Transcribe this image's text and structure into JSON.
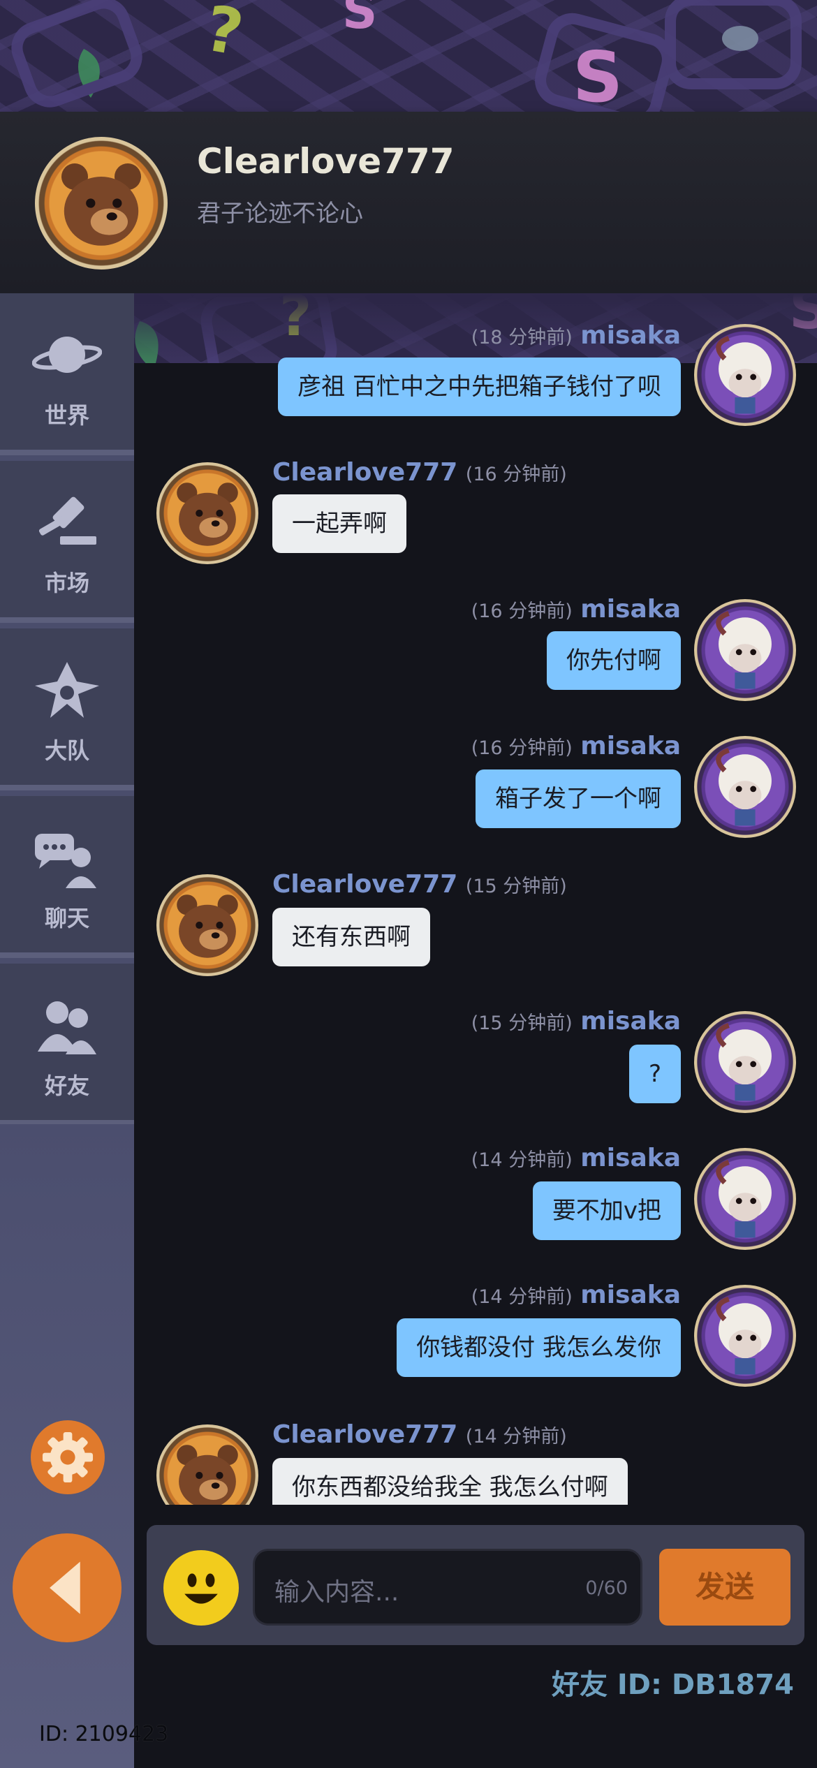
{
  "header": {
    "name": "Clearlove777",
    "motto": "君子论迹不论心"
  },
  "sidebar": {
    "items": [
      {
        "label": "世界",
        "icon": "planet-icon"
      },
      {
        "label": "市场",
        "icon": "gavel-icon"
      },
      {
        "label": "大队",
        "icon": "guild-emblem-icon"
      },
      {
        "label": "聊天",
        "icon": "chat-icon"
      },
      {
        "label": "好友",
        "icon": "friends-icon"
      }
    ],
    "settings_icon": "gear-icon",
    "back_icon": "back-arrow-icon"
  },
  "messages": [
    {
      "sender": "misaka",
      "time": "(18 分钟前)",
      "text": "彦祖 百忙中之中先把箱子钱付了呗",
      "mine": true
    },
    {
      "sender": "Clearlove777",
      "time": "(16 分钟前)",
      "text": "一起弄啊",
      "mine": false
    },
    {
      "sender": "misaka",
      "time": "(16 分钟前)",
      "text": "你先付啊",
      "mine": true
    },
    {
      "sender": "misaka",
      "time": "(16 分钟前)",
      "text": "箱子发了一个啊",
      "mine": true
    },
    {
      "sender": "Clearlove777",
      "time": "(15 分钟前)",
      "text": "还有东西啊",
      "mine": false
    },
    {
      "sender": "misaka",
      "time": "(15 分钟前)",
      "text": "?",
      "mine": true
    },
    {
      "sender": "misaka",
      "time": "(14 分钟前)",
      "text": "要不加v把",
      "mine": true
    },
    {
      "sender": "misaka",
      "time": "(14 分钟前)",
      "text": "你钱都没付 我怎么发你",
      "mine": true
    },
    {
      "sender": "Clearlove777",
      "time": "(14 分钟前)",
      "text": "你东西都没给我全 我怎么付啊",
      "mine": false
    }
  ],
  "composer": {
    "placeholder": "输入内容...",
    "counter": "0/60",
    "send_label": "发送",
    "emoji_icon": "smiley-icon"
  },
  "footer": {
    "friend_id": "好友 ID: DB1874",
    "user_id": "ID: 2109423"
  },
  "colors": {
    "accent_orange": "#e07a2c",
    "my_bubble": "#7ec5ff",
    "their_bubble": "#eceef0",
    "sender_name": "#7b94cf"
  }
}
